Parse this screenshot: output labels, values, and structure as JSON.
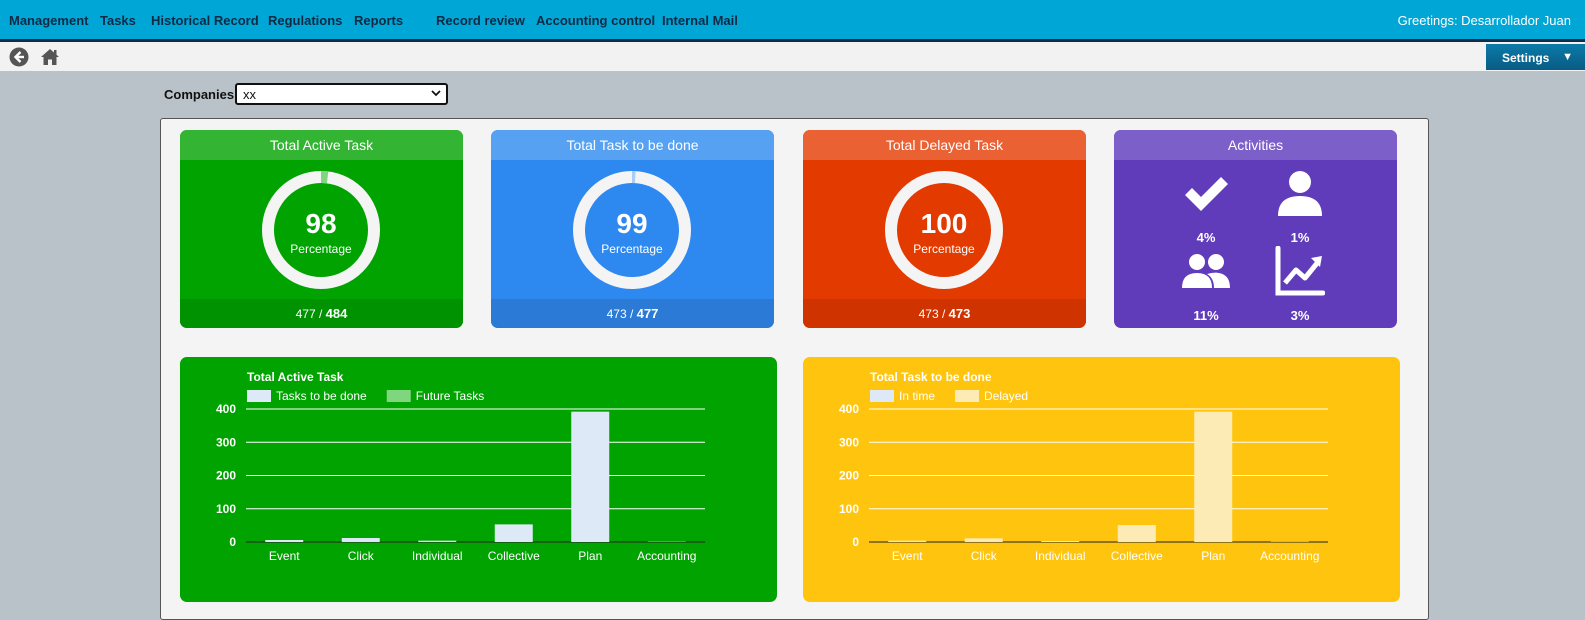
{
  "nav": {
    "items": [
      "Management",
      "Tasks",
      "Historical Record",
      "Regulations",
      "Reports",
      "Record review",
      "Accounting control",
      "Internal Mail"
    ],
    "greeting": "Greetings: Desarrollador Juan"
  },
  "toolbar": {
    "back_icon": "back-arrow-icon",
    "home_icon": "home-icon",
    "settings_label": "Settings"
  },
  "filter": {
    "label": "Companies",
    "selected": "xx"
  },
  "cards": [
    {
      "title": "Total Active Task",
      "percent": "98",
      "percent_value": 98,
      "percent_label": "Percentage",
      "done": "477",
      "total": "484",
      "color": "#00a300"
    },
    {
      "title": "Total Task to be done",
      "percent": "99",
      "percent_value": 99,
      "percent_label": "Percentage",
      "done": "473",
      "total": "477",
      "color": "#2d89ef"
    },
    {
      "title": "Total Delayed Task",
      "percent": "100",
      "percent_value": 100,
      "percent_label": "Percentage",
      "done": "473",
      "total": "473",
      "color": "#e33a00"
    }
  ],
  "activities": {
    "title": "Activities",
    "items": [
      {
        "icon": "check-icon",
        "value": "4%"
      },
      {
        "icon": "user-icon",
        "value": "1%"
      },
      {
        "icon": "users-icon",
        "value": "11%"
      },
      {
        "icon": "trend-chart-icon",
        "value": "3%"
      }
    ],
    "color": "#603cba"
  },
  "chart_data": [
    {
      "type": "bar",
      "title": "Total Active Task",
      "categories": [
        "Event",
        "Click",
        "Individual",
        "Collective",
        "Plan",
        "Accounting"
      ],
      "series": [
        {
          "name": "Tasks to be done",
          "values": [
            6,
            12,
            4,
            53,
            392,
            1
          ],
          "color": "#dde9f7"
        },
        {
          "name": "Future Tasks",
          "values": [
            0,
            0,
            0,
            0,
            0,
            0
          ],
          "color": "#7fd67f"
        }
      ],
      "yticks": [
        0,
        100,
        200,
        300,
        400
      ],
      "ylim": [
        0,
        400
      ],
      "background": "#00a300"
    },
    {
      "type": "bar",
      "title": "Total Task to be done",
      "categories": [
        "Event",
        "Click",
        "Individual",
        "Collective",
        "Plan",
        "Accounting"
      ],
      "series": [
        {
          "name": "In time",
          "values": [
            0,
            0,
            0,
            0,
            0,
            0
          ],
          "color": "#dde9f7"
        },
        {
          "name": "Delayed",
          "values": [
            4,
            11,
            3,
            51,
            392,
            1
          ],
          "color": "#fdebb6"
        }
      ],
      "yticks": [
        0,
        100,
        200,
        300,
        400
      ],
      "ylim": [
        0,
        400
      ],
      "background": "#ffc40d"
    }
  ]
}
